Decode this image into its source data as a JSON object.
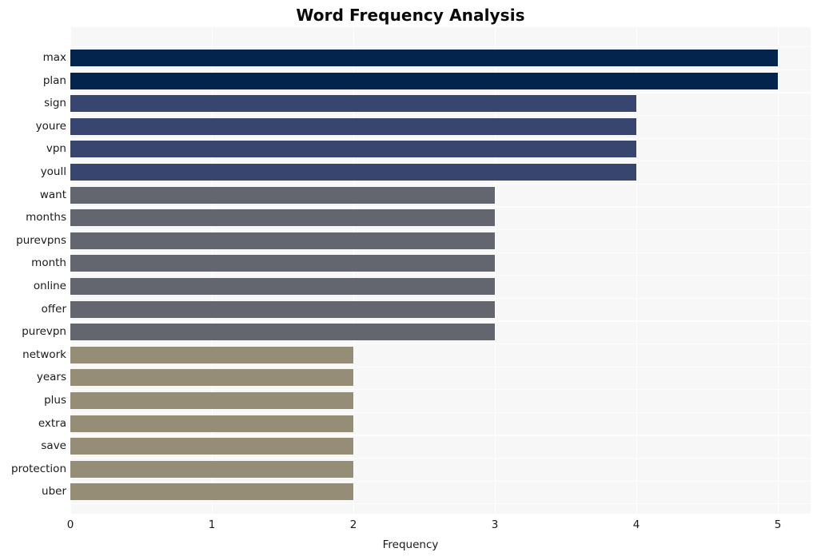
{
  "chart_data": {
    "type": "bar",
    "orientation": "horizontal",
    "title": "Word Frequency Analysis",
    "xlabel": "Frequency",
    "ylabel": "",
    "xlim": [
      0,
      5
    ],
    "xticks": [
      "0",
      "1",
      "2",
      "3",
      "4",
      "5"
    ],
    "grid": true,
    "legend": "none",
    "categories": [
      "max",
      "plan",
      "sign",
      "youre",
      "vpn",
      "youll",
      "want",
      "months",
      "purevpns",
      "month",
      "online",
      "offer",
      "purevpn",
      "network",
      "years",
      "plus",
      "extra",
      "save",
      "protection",
      "uber"
    ],
    "values": [
      5,
      5,
      4,
      4,
      4,
      4,
      3,
      3,
      3,
      3,
      3,
      3,
      3,
      2,
      2,
      2,
      2,
      2,
      2,
      2
    ],
    "bar_colors": [
      "#03244d",
      "#03244d",
      "#38456e",
      "#38456e",
      "#38456e",
      "#38456e",
      "#63666f",
      "#63666f",
      "#63666f",
      "#63666f",
      "#63666f",
      "#63666f",
      "#63666f",
      "#968d76",
      "#968d76",
      "#968d76",
      "#968d76",
      "#968d76",
      "#968d76",
      "#968d76"
    ],
    "plot_background": "#f7f7f8",
    "gridline_color": "#ffffff",
    "text_color": "#1a1a1a",
    "title_color": "#0a0a0a"
  }
}
